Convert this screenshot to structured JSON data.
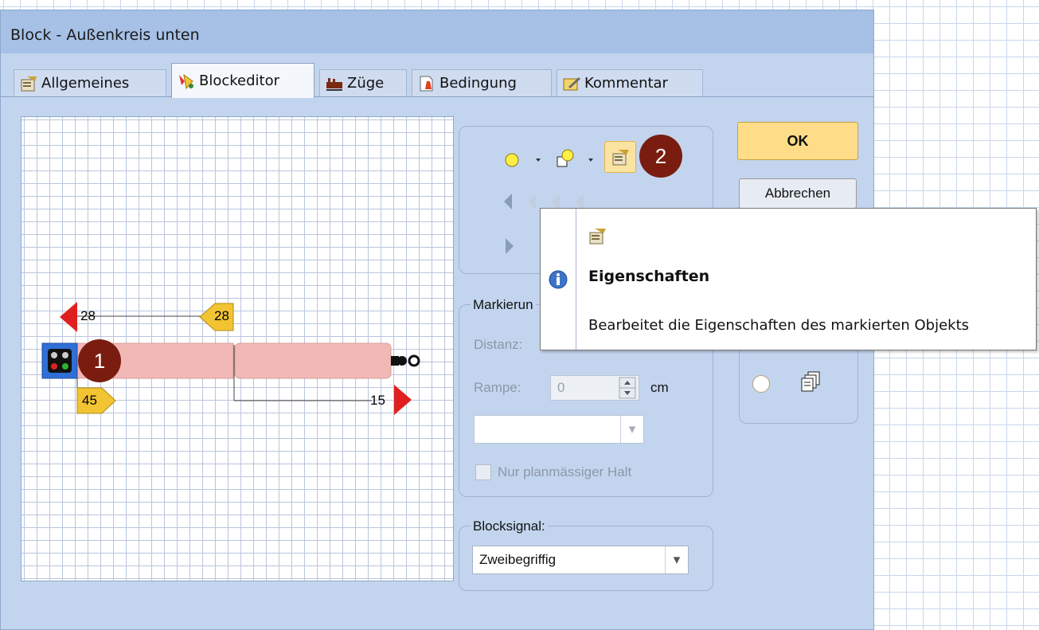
{
  "window": {
    "title": "Block - Außenkreis unten"
  },
  "tabs": [
    {
      "label": "Allgemeines",
      "icon": "properties-icon"
    },
    {
      "label": "Blockeditor",
      "icon": "block-editor-icon"
    },
    {
      "label": "Züge",
      "icon": "trains-icon"
    },
    {
      "label": "Bedingung",
      "icon": "condition-icon"
    },
    {
      "label": "Kommentar",
      "icon": "comment-icon"
    }
  ],
  "editor": {
    "markers": [
      {
        "value": "28"
      },
      {
        "value": "28"
      },
      {
        "value": "45"
      },
      {
        "value": "15"
      }
    ],
    "callout1": "1"
  },
  "toolbar": {
    "callout2": "2"
  },
  "markierung": {
    "label": "Markierun",
    "distanz_label": "Distanz:",
    "rampe_label": "Rampe:",
    "rampe_value": "0",
    "rampe_unit": "cm",
    "select_value": "",
    "checkbox_label": "Nur planmässiger Halt"
  },
  "blocksignal": {
    "label": "Blocksignal:",
    "value": "Zweibegriffig"
  },
  "buttons": {
    "ok": "OK",
    "cancel": "Abbrechen"
  },
  "tooltip": {
    "title": "Eigenschaften",
    "description": "Bearbeitet die Eigenschaften des markierten Objekts"
  },
  "colors": {
    "titlebar": "#a6c0e6",
    "dialog": "#c3d5ee",
    "block": "#f2b8b5",
    "callout": "#7a1d10",
    "ok_button": "#ffdd88"
  }
}
